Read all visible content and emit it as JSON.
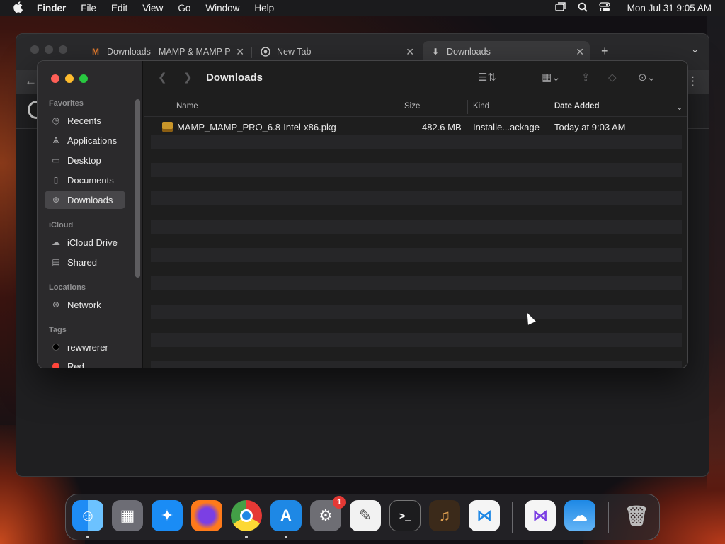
{
  "menubar": {
    "app_name": "Finder",
    "items": [
      "File",
      "Edit",
      "View",
      "Go",
      "Window",
      "Help"
    ],
    "clock": "Mon Jul 31  9:05 AM",
    "icons": [
      "window-icon",
      "search-icon",
      "control-center-icon"
    ]
  },
  "browser": {
    "tabs": [
      {
        "label": "Downloads - MAMP & MAMP P",
        "icon": "mamp-icon"
      },
      {
        "label": "New Tab",
        "icon": "chrome-icon"
      },
      {
        "label": "Downloads",
        "icon": "download-icon"
      }
    ]
  },
  "finder": {
    "title": "Downloads",
    "sidebar": {
      "favorites_label": "Favorites",
      "favorites": [
        {
          "label": "Recents",
          "icon": "clock-icon"
        },
        {
          "label": "Applications",
          "icon": "applications-icon"
        },
        {
          "label": "Desktop",
          "icon": "desktop-icon"
        },
        {
          "label": "Documents",
          "icon": "document-icon"
        },
        {
          "label": "Downloads",
          "icon": "download-icon"
        }
      ],
      "icloud_label": "iCloud",
      "icloud": [
        {
          "label": "iCloud Drive",
          "icon": "cloud-icon"
        },
        {
          "label": "Shared",
          "icon": "shared-folder-icon"
        }
      ],
      "locations_label": "Locations",
      "locations": [
        {
          "label": "Network",
          "icon": "globe-icon"
        }
      ],
      "tags_label": "Tags",
      "tags": [
        {
          "label": "rewwrerer",
          "color": "#000000"
        },
        {
          "label": "Red",
          "color": "#ff453a"
        }
      ]
    },
    "columns": {
      "name": "Name",
      "size": "Size",
      "kind": "Kind",
      "date": "Date Added"
    },
    "files": [
      {
        "name": "MAMP_MAMP_PRO_6.8-Intel-x86.pkg",
        "size": "482.6 MB",
        "kind": "Installe...ackage",
        "date": "Today at 9:03 AM"
      }
    ]
  },
  "dock": {
    "apps": [
      "Finder",
      "Launchpad",
      "Safari",
      "Firefox",
      "Chrome",
      "App Store",
      "System Settings",
      "TextEdit",
      "Terminal",
      "GarageBand",
      "Visual Studio Code",
      "Visual Studio",
      "Weather",
      "Trash"
    ],
    "badge": "1"
  }
}
